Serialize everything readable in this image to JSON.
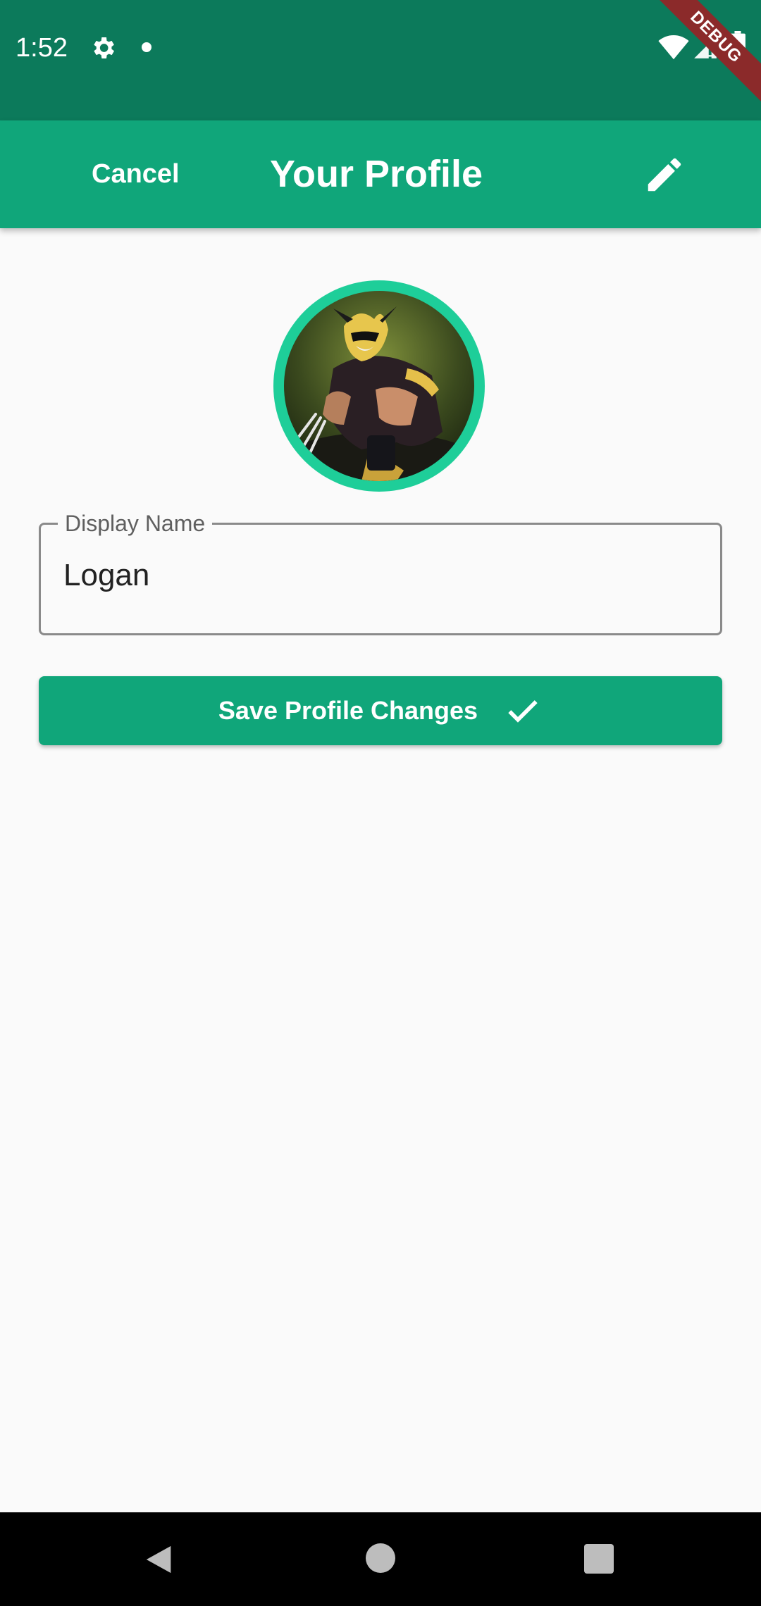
{
  "status_bar": {
    "time": "1:52",
    "icons": [
      "gear-icon",
      "notification-dot-icon",
      "wifi-icon",
      "signal-icon",
      "battery-icon"
    ]
  },
  "debug_banner": {
    "label": "DEBUG",
    "color": "#8B2A2A"
  },
  "app_bar": {
    "cancel_label": "Cancel",
    "title": "Your Profile",
    "edit_icon": "pencil-icon"
  },
  "profile": {
    "avatar_icon": "avatar-wolverine-image",
    "display_name_label": "Display Name",
    "display_name_value": "Logan"
  },
  "actions": {
    "save_label": "Save Profile Changes",
    "save_icon": "check-icon"
  },
  "nav_bar": {
    "icons": [
      "back-icon",
      "home-icon",
      "recents-icon"
    ]
  },
  "colors": {
    "status_bar": "#0C7A5B",
    "primary": "#10A67A",
    "avatar_ring": "#1ECE99",
    "background": "#FAFAFA"
  }
}
